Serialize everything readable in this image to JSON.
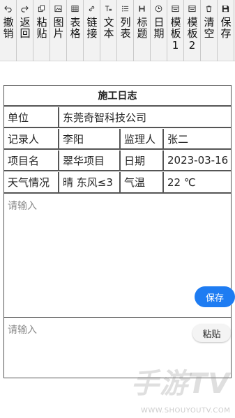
{
  "toolbar": {
    "items": [
      {
        "label": "撤销",
        "icon": "undo-icon"
      },
      {
        "label": "返回",
        "icon": "redo-icon"
      },
      {
        "label": "粘贴",
        "icon": "paste-icon"
      },
      {
        "label": "图片",
        "icon": "image-icon"
      },
      {
        "label": "表格",
        "icon": "table-icon"
      },
      {
        "label": "链接",
        "icon": "link-icon"
      },
      {
        "label": "文本",
        "icon": "text-format-icon"
      },
      {
        "label": "列表",
        "icon": "list-icon"
      },
      {
        "label": "标题",
        "icon": "heading-icon"
      },
      {
        "label": "日期",
        "icon": "clock-icon"
      },
      {
        "label": "模板1",
        "icon": "template-icon"
      },
      {
        "label": "模板2",
        "icon": "template-icon"
      },
      {
        "label": "清空",
        "icon": "trash-icon"
      },
      {
        "label": "保存",
        "icon": "save-icon"
      }
    ]
  },
  "form": {
    "title": "施工日志",
    "unit_label": "单位",
    "unit_value": "东莞奇智科技公司",
    "recorder_label": "记录人",
    "recorder_value": "李阳",
    "supervisor_label": "监理人",
    "supervisor_value": "张二",
    "project_label": "项目名",
    "project_value": "翠华项目",
    "date_label": "日期",
    "date_value": "2023-03-16",
    "weather_label": "天气情况",
    "weather_value": "晴 东风≤3",
    "temp_label": "气温",
    "temp_value": "22 ℃"
  },
  "editor": {
    "placeholder_1": "请输入",
    "save_label": "保存",
    "placeholder_2": "请输入",
    "paste_label": "粘贴"
  },
  "watermark": {
    "brand": "手游TV",
    "site": "WWW.SHOUYOUTV.COM"
  },
  "colors": {
    "accent": "#1e7cf2",
    "border": "#555555"
  }
}
